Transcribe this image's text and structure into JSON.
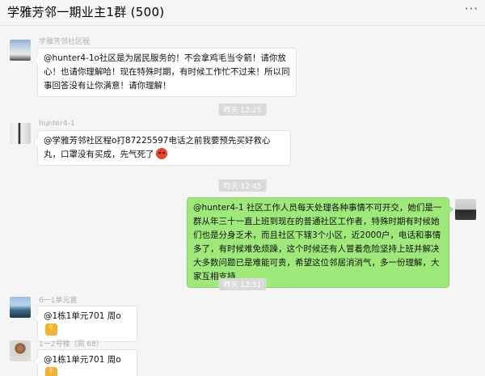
{
  "header": {
    "title": "学雅芳邻一期业主1群 (500)",
    "more_label": "···"
  },
  "messages": [
    {
      "sender": "学雅芳邻社区程",
      "text": "@hunter4-1o社区是为居民服务的！不会拿鸡毛当令箭！请你放心！也请你理解哈！现在特殊时期，有时候工作忙不过来！所以同事回答没有让你满意！请你理解！",
      "avatar_icon": "landscape-avatar-icon"
    },
    {
      "time": "昨天 12:25"
    },
    {
      "sender": "hunter4-1",
      "text": "@学雅芳邻社区程o打87225597电话之前我要预先买好救心丸，口罩没有买成，先气死了",
      "emoji": "angry-face-icon",
      "avatar_icon": "person-avatar-icon"
    },
    {
      "time": "昨天 12:45"
    },
    {
      "sender": "",
      "text": "@hunter4-1 社区工作人员每天处理各种事情不可开交，她们是一群从年三十一直上班到现在的普通社区工作者，特殊时期有时候她们也是分身乏术，而且社区下辖3个小区，近2000户，电话和事情多了，有时候难免烦躁，这个时候还有人冒着危险坚持上班并解决大多数问题已是难能可贵，希望这位邻居消消气，多一份理解，大家互相支持",
      "avatar_icon": "self-avatar-icon"
    },
    {
      "time": "昨天 12:51"
    },
    {
      "sender": "6一1单元富",
      "text": "@1栋1单元701 周o",
      "emoji": "thumbs-up-icon",
      "avatar_icon": "scenery-avatar-icon"
    },
    {
      "sender": "1一2号楼（周 68）",
      "text": "@1栋1单元701 周o",
      "emoji": "thumbs-up-icon",
      "avatar_icon": "mushroom-avatar-icon"
    }
  ],
  "colors": {
    "background": "#f5f5f5",
    "self_bubble": "#9fe87a",
    "other_bubble": "#ffffff",
    "time_badge": "#dadada",
    "sender_text": "#b0b0b0"
  }
}
